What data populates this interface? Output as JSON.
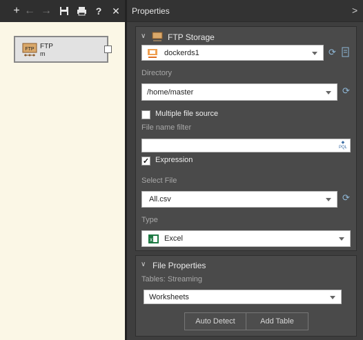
{
  "toolbar": {
    "add": "+",
    "back": "←",
    "forward": "→",
    "save": "💾",
    "print": "🖶",
    "help": "?",
    "close": "✕"
  },
  "canvas": {
    "node": {
      "icon_text": "FTP",
      "name": "FTP",
      "subtitle": "m"
    }
  },
  "panel": {
    "title": "Properties",
    "collapse_icon": ">",
    "ftp_storage": {
      "title": "FTP Storage",
      "connection": "dockerds1",
      "directory_label": "Directory",
      "directory": "/home/master",
      "multiple_file_label": "Multiple file source",
      "multiple_file_checked": false,
      "filter_label": "File name filter",
      "filter_value": "",
      "filter_icon_text": "PQL",
      "expression_label": "Expression",
      "expression_checked": true,
      "select_file_label": "Select File",
      "select_file": "All.csv",
      "type_label": "Type",
      "type_value": "Excel"
    },
    "file_properties": {
      "title": "File Properties",
      "tables_label": "Tables: Streaming",
      "tables_value": "Worksheets",
      "auto_detect": "Auto Detect",
      "add_table": "Add Table"
    }
  }
}
